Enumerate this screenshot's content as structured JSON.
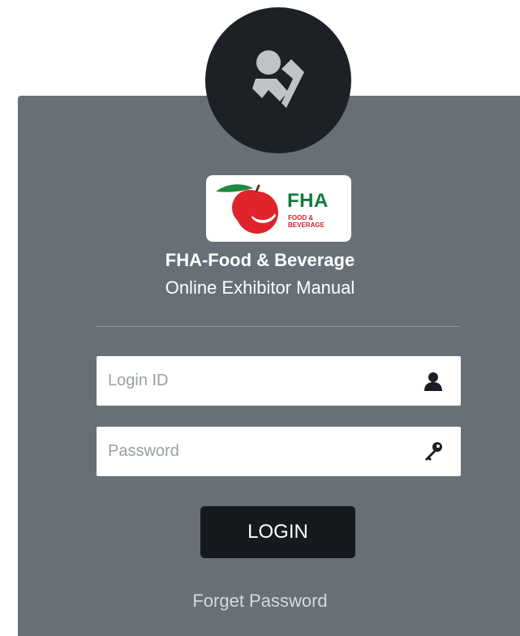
{
  "logo": {
    "brand": "FHA",
    "sub_line1": "FOOD &",
    "sub_line2": "BEVERAGE"
  },
  "header": {
    "title": "FHA-Food & Beverage",
    "subtitle": "Online Exhibitor Manual"
  },
  "form": {
    "login_id_placeholder": "Login ID",
    "login_id_value": "",
    "password_placeholder": "Password",
    "password_value": "",
    "login_label": "LOGIN",
    "forget_label": "Forget Password"
  },
  "icons": {
    "avatar": "exhibitor-user-icon",
    "login_id": "user-icon",
    "password": "key-icon"
  },
  "colors": {
    "panel": "#686f77",
    "avatar_circle": "#1d2025",
    "button": "#161a1f",
    "brand_green": "#0f7a3a",
    "brand_red": "#d3202a"
  }
}
